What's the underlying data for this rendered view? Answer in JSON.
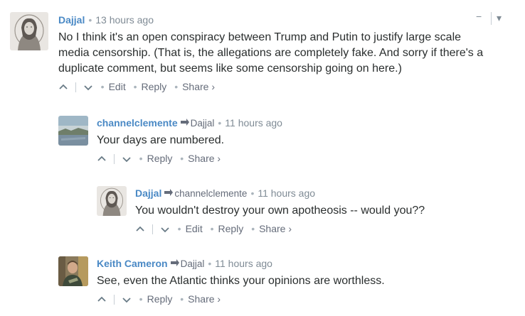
{
  "comments": [
    {
      "author": "Dajjal",
      "reply_to": "",
      "time": "13 hours ago",
      "text_lines": [
        "No I think it's an open conspiracy between Trump and Putin to justify large scale",
        "media censorship. (That is, the allegations are completely fake. And sorry if there's a",
        "duplicate comment, but seems like some censorship going on here.)"
      ],
      "actions": [
        "Edit",
        "Reply",
        "Share ›"
      ]
    },
    {
      "author": "channelclemente",
      "reply_to": "Dajjal",
      "time": "11 hours ago",
      "text_lines": [
        "Your days are numbered."
      ],
      "actions": [
        "Reply",
        "Share ›"
      ]
    },
    {
      "author": "Dajjal",
      "reply_to": "channelclemente",
      "time": "11 hours ago",
      "text_lines": [
        "You wouldn't destroy your own apotheosis -- would you??"
      ],
      "actions": [
        "Edit",
        "Reply",
        "Share ›"
      ]
    },
    {
      "author": "Keith Cameron",
      "reply_to": "Dajjal",
      "time": "11 hours ago",
      "text_lines": [
        "See, even the Atlantic thinks your opinions are worthless."
      ],
      "actions": [
        "Reply",
        "Share ›"
      ]
    }
  ],
  "controls": {
    "collapse": "−",
    "menu": "▾"
  },
  "separator": "•",
  "icons": {
    "upvote": "chevron-up-icon",
    "downvote": "chevron-down-icon",
    "reply_arrow": "reply-arrow-icon"
  },
  "colors": {
    "author": "#4a89c5",
    "text": "#2a2e2e",
    "meta": "#7f8b95"
  }
}
